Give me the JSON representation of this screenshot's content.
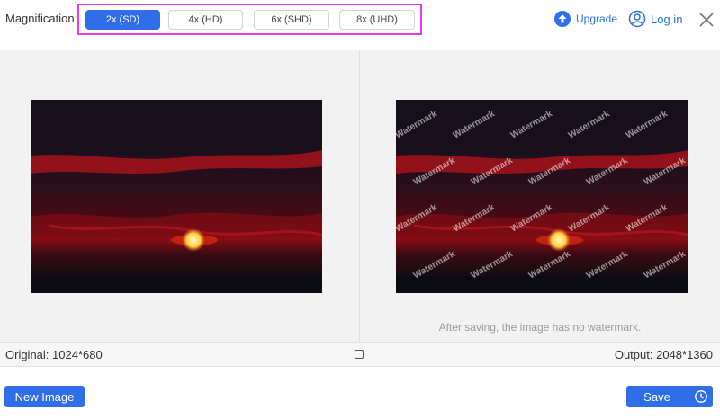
{
  "toolbar": {
    "magnification_label": "Magnification:",
    "options": [
      {
        "label": "2x (SD)",
        "selected": true
      },
      {
        "label": "4x (HD)",
        "selected": false
      },
      {
        "label": "6x (SHD)",
        "selected": false
      },
      {
        "label": "8x (UHD)",
        "selected": false
      }
    ],
    "upgrade_label": "Upgrade",
    "login_label": "Log in"
  },
  "preview": {
    "watermark_text": "Watermark",
    "note": "After saving, the image has no watermark."
  },
  "infobar": {
    "original": "Original: 1024*680",
    "output": "Output: 2048*1360"
  },
  "actions": {
    "new_image_label": "New Image",
    "save_label": "Save"
  },
  "colors": {
    "accent": "#2f6ee8",
    "highlight_border": "#e83ce8",
    "panel_bg": "#f2f2f2"
  }
}
